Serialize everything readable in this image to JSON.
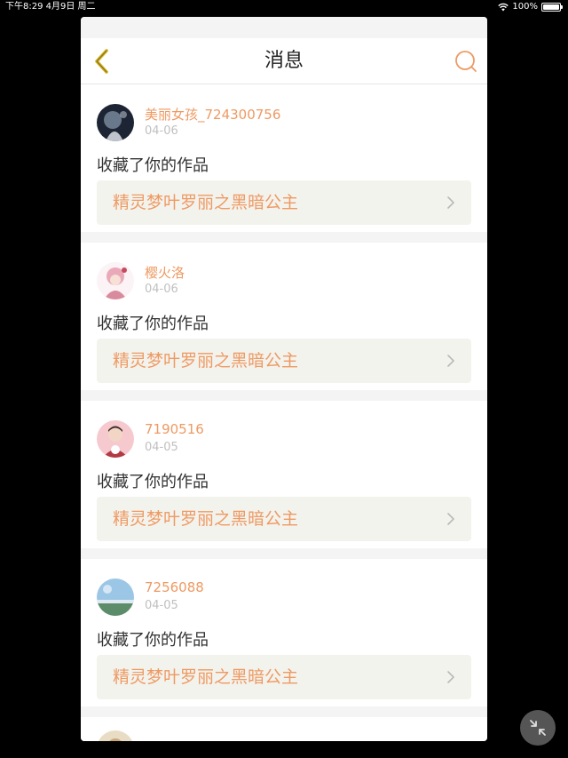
{
  "status_bar": {
    "time_date": "下午8:29  4月9日 周二",
    "battery": "100%",
    "battery_level": 1.0
  },
  "nav": {
    "title": "消息",
    "back_icon": "chevron-left-icon",
    "search_icon": "search-icon"
  },
  "colors": {
    "accent": "#ee9a63",
    "back_arrow": "#d6b422",
    "date": "#c0c0c0",
    "link_bg": "#f3f3ee"
  },
  "messages": [
    {
      "user": "美丽女孩_724300756",
      "date": "04-06",
      "text": "收藏了你的作品",
      "work": "精灵梦叶罗丽之黑暗公主"
    },
    {
      "user": "樱火洛",
      "date": "04-06",
      "text": "收藏了你的作品",
      "work": "精灵梦叶罗丽之黑暗公主"
    },
    {
      "user": "7190516",
      "date": "04-05",
      "text": "收藏了你的作品",
      "work": "精灵梦叶罗丽之黑暗公主"
    },
    {
      "user": "7256088",
      "date": "04-05",
      "text": "收藏了你的作品",
      "work": "精灵梦叶罗丽之黑暗公主"
    }
  ],
  "float_button_icon": "collapse-arrows-icon"
}
